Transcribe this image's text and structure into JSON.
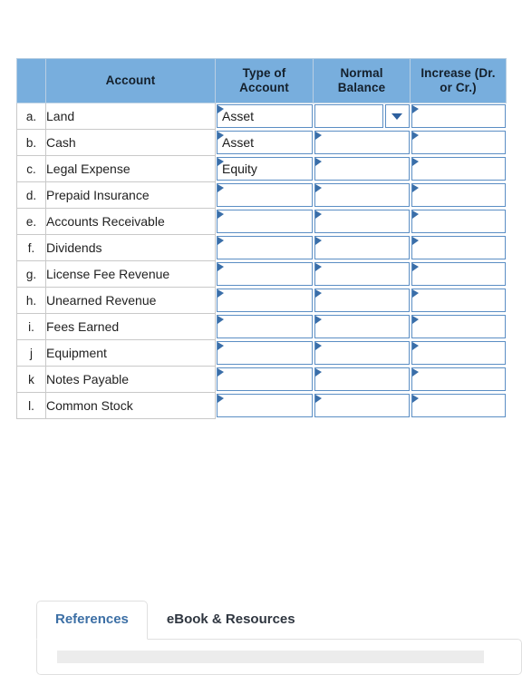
{
  "worksheet": {
    "columns": [
      {
        "key": "label",
        "header": ""
      },
      {
        "key": "acct",
        "header": "Account"
      },
      {
        "key": "type",
        "header": "Type of Account"
      },
      {
        "key": "normal",
        "header": "Normal Balance"
      },
      {
        "key": "incr",
        "header": "Increase (Dr. or Cr.)"
      }
    ],
    "header_lines": {
      "blank": "",
      "account": "Account",
      "type_of_account": [
        "Type of",
        "Account"
      ],
      "normal_balance": [
        "Normal",
        "Balance"
      ],
      "increase": [
        "Increase (Dr.",
        "or Cr.)"
      ]
    },
    "rows": [
      {
        "label": "a.",
        "account": "Land",
        "type": "Asset",
        "normal": "",
        "increase": "",
        "normal_has_dropdown": true
      },
      {
        "label": "b.",
        "account": "Cash",
        "type": "Asset",
        "normal": "",
        "increase": "",
        "normal_has_dropdown": false
      },
      {
        "label": "c.",
        "account": "Legal Expense",
        "type": "Equity",
        "normal": "",
        "increase": "",
        "normal_has_dropdown": false
      },
      {
        "label": "d.",
        "account": "Prepaid Insurance",
        "type": "",
        "normal": "",
        "increase": "",
        "normal_has_dropdown": false
      },
      {
        "label": "e.",
        "account": "Accounts Receivable",
        "type": "",
        "normal": "",
        "increase": "",
        "normal_has_dropdown": false
      },
      {
        "label": "f.",
        "account": "Dividends",
        "type": "",
        "normal": "",
        "increase": "",
        "normal_has_dropdown": false
      },
      {
        "label": "g.",
        "account": "License Fee Revenue",
        "type": "",
        "normal": "",
        "increase": "",
        "normal_has_dropdown": false
      },
      {
        "label": "h.",
        "account": "Unearned Revenue",
        "type": "",
        "normal": "",
        "increase": "",
        "normal_has_dropdown": false
      },
      {
        "label": "i.",
        "account": "Fees Earned",
        "type": "",
        "normal": "",
        "increase": "",
        "normal_has_dropdown": false
      },
      {
        "label": "j",
        "account": "Equipment",
        "type": "",
        "normal": "",
        "increase": "",
        "normal_has_dropdown": false
      },
      {
        "label": "k",
        "account": "Notes Payable",
        "type": "",
        "normal": "",
        "increase": "",
        "normal_has_dropdown": false
      },
      {
        "label": "l.",
        "account": "Common Stock",
        "type": "",
        "normal": "",
        "increase": "",
        "normal_has_dropdown": false
      }
    ]
  },
  "tabs": {
    "items": [
      {
        "label": "References",
        "active": true
      },
      {
        "label": "eBook & Resources",
        "active": false
      }
    ]
  },
  "colors": {
    "header_blue": "#78aedd",
    "field_border_blue": "#5b8ec4",
    "marker_blue": "#3a6ea8",
    "tab_active_text": "#3c6fa5",
    "grid_gray": "#c9c9c9"
  },
  "icons": {
    "dropdown_caret": "chevron-down-icon",
    "cell_marker": "triangle-marker-icon"
  }
}
